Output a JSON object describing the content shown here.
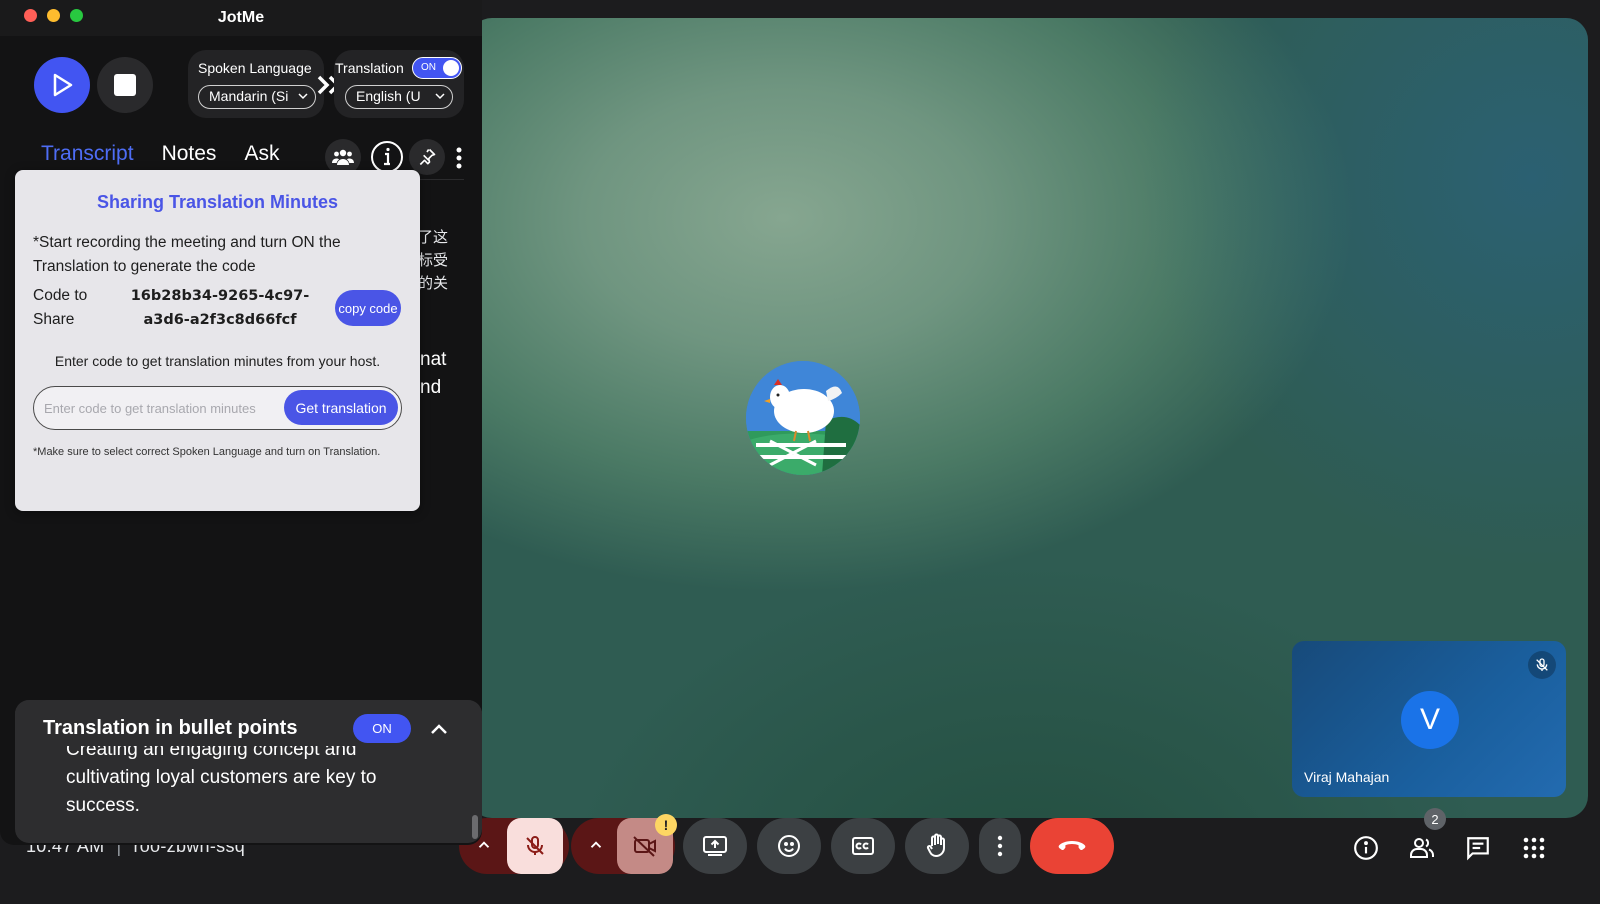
{
  "app": {
    "title": "JotMe"
  },
  "language": {
    "spoken_label": "Spoken Language",
    "spoken_value": "Mandarin (Si",
    "translation_label": "Translation",
    "translation_toggle": "ON",
    "translation_value": "English (U"
  },
  "tabs": [
    "Transcript",
    "Notes",
    "Ask"
  ],
  "behind": {
    "zh_lines": [
      "了这",
      "标受",
      "的关"
    ],
    "en_lines": [
      "nat",
      "nd"
    ]
  },
  "popup": {
    "title": "Sharing Translation Minutes",
    "description": "*Start recording the meeting and turn ON the Translation to generate the code",
    "code_label": "Code to Share",
    "code": "16b28b34-9265-4c97-a3d6-a2f3c8d66fcf",
    "copy_button": "copy code",
    "enter_text": "Enter code to get translation minutes from your host.",
    "input_placeholder": "Enter code to get translation minutes",
    "get_button": "Get translation",
    "note": "*Make sure to select correct Spoken Language and turn on Translation."
  },
  "bullets": {
    "title": "Translation in bullet points",
    "toggle": "ON",
    "text": "Creating an engaging concept and cultivating loyal customers are key to success."
  },
  "meeting": {
    "time": "10:47 AM",
    "separator": "|",
    "code": "roo-zbwn-ssq",
    "participant_count": "2",
    "self_initial": "V",
    "self_name": "Viraj Mahajan"
  },
  "colors": {
    "accent": "#4255f2",
    "end_call": "#ea4335",
    "mic_off_bg": "#f9dedc"
  }
}
